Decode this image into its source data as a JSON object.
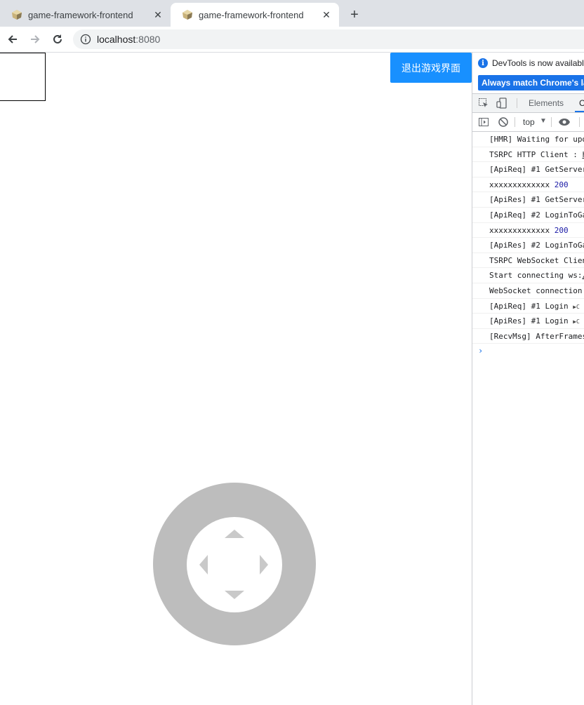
{
  "tabs": [
    {
      "title": "game-framework-frontend",
      "active": false
    },
    {
      "title": "game-framework-frontend",
      "active": true
    }
  ],
  "toolbar": {
    "url_host": "localhost",
    "url_port": ":8080"
  },
  "page": {
    "exit_button_label": "退出游戏界面"
  },
  "devtools": {
    "banner_text": "DevTools is now available",
    "banner_button": "Always match Chrome's lan",
    "tab_elements": "Elements",
    "tab_console": "C",
    "context": "top",
    "console_lines": [
      {
        "text": "[HMR] Waiting for upd",
        "num": ""
      },
      {
        "text": "TSRPC HTTP Client : ",
        "num": "",
        "link": "h"
      },
      {
        "text": "[ApiReq] #1 GetServer",
        "num": ""
      },
      {
        "text": "xxxxxxxxxxxxx ",
        "num": "200"
      },
      {
        "text": "[ApiRes] #1 GetServer",
        "num": ""
      },
      {
        "text": "[ApiReq] #2 LoginToGa",
        "num": ""
      },
      {
        "text": "xxxxxxxxxxxxx ",
        "num": "200"
      },
      {
        "text": "[ApiRes] #2 LoginToGa",
        "num": ""
      },
      {
        "text": "TSRPC WebSocket Clien",
        "num": ""
      },
      {
        "text": "Start connecting ws:",
        "num": "",
        "link": "/"
      },
      {
        "text": "WebSocket connection ",
        "num": ""
      },
      {
        "text": "[ApiReq] #1 Login ",
        "num": "",
        "expand": "▶C"
      },
      {
        "text": "[ApiRes] #1 Login ",
        "num": "",
        "expand": "▶C"
      },
      {
        "text": "[RecvMsg] AfterFrames",
        "num": ""
      }
    ],
    "prompt": "›"
  },
  "colors": {
    "exit_button_bg": "#1890ff",
    "joystick_ring": "#bdbdbd",
    "devtools_accent": "#1a73e8"
  }
}
